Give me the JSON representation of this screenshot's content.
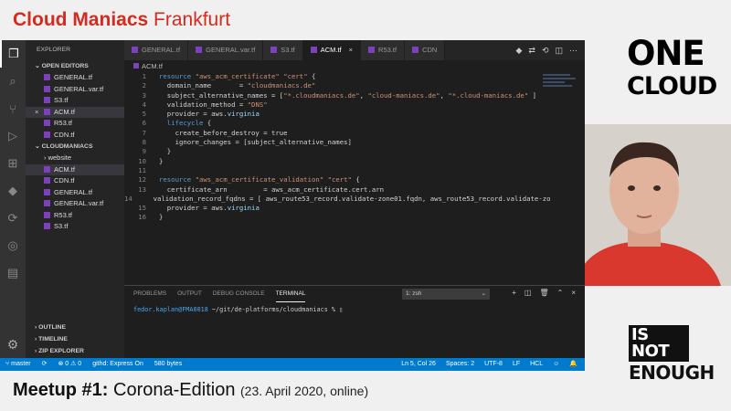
{
  "header": {
    "brand": "Cloud Maniacs",
    "city": "Frankfurt"
  },
  "footer": {
    "meetup": "Meetup #1:",
    "edition": "Corona-Edition",
    "date": "(23. April 2020, online)"
  },
  "logo": {
    "one": "ONE",
    "cloud": "CLOUD",
    "isnot": "IS NOT",
    "enough": "ENOUGH"
  },
  "colors": {
    "brand": "#d62a1e",
    "statusbar": "#007acc",
    "terraform": "#7b42bc"
  },
  "activity_icons": [
    "files-icon",
    "search-icon",
    "source-control-icon",
    "debug-icon",
    "extensions-icon",
    "terraform-icon",
    "remote-icon",
    "gitlens-icon",
    "docker-icon"
  ],
  "sidebar": {
    "title": "EXPLORER",
    "open_editors_label": "OPEN EDITORS",
    "open_editors": [
      "GENERAL.tf",
      "GENERAL.var.tf",
      "S3.tf",
      "ACM.tf",
      "R53.tf",
      "CDN.tf"
    ],
    "folder_label": "CLOUDMANIACS",
    "folder_items": [
      "website",
      "ACM.tf",
      "CDN.tf",
      "GENERAL.tf",
      "GENERAL.var.tf",
      "R53.tf",
      "S3.tf"
    ],
    "outline": "OUTLINE",
    "timeline": "TIMELINE",
    "zip": "ZIP EXPLORER"
  },
  "tabs": [
    "GENERAL.tf",
    "GENERAL.var.tf",
    "S3.tf",
    "ACM.tf",
    "R53.tf",
    "CDN"
  ],
  "breadcrumb": "ACM.tf",
  "code_lines": [
    "resource \"aws_acm_certificate\" \"cert\" {",
    "  domain_name       = \"cloudmaniacs.de\"",
    "  subject_alternative_names = [\"*.cloudmaniacs.de\", \"cloud-maniacs.de\", \"*.cloud-maniacs.de\" ]",
    "  validation_method = \"DNS\"",
    "  provider = aws.virginia",
    "  lifecycle {",
    "    create_before_destroy = true",
    "    ignore_changes = [subject_alternative_names]",
    "  }",
    "}",
    "",
    "resource \"aws_acm_certificate_validation\" \"cert\" {",
    "  certificate_arn         = aws_acm_certificate.cert.arn",
    "  validation_record_fqdns = [ aws_route53_record.validate-zone01.fqdn, aws_route53_record.validate-zo",
    "  provider = aws.virginia",
    "}"
  ],
  "panel": {
    "tabs": [
      "PROBLEMS",
      "OUTPUT",
      "DEBUG CONSOLE",
      "TERMINAL"
    ],
    "shell": "1: zsh",
    "prompt_user": "fedor.kaplan@FMA0018",
    "prompt_path": " ~/git/de-platforms/cloudmaniacs % "
  },
  "statusbar": {
    "branch": "master",
    "sync": "⟳",
    "problems": "⊗ 0 ⚠ 0",
    "githd": "githd: Express On",
    "bytes": "580 bytes",
    "position": "Ln 5, Col 26",
    "spaces": "Spaces: 2",
    "encoding": "UTF-8",
    "eol": "LF",
    "language": "HCL"
  }
}
